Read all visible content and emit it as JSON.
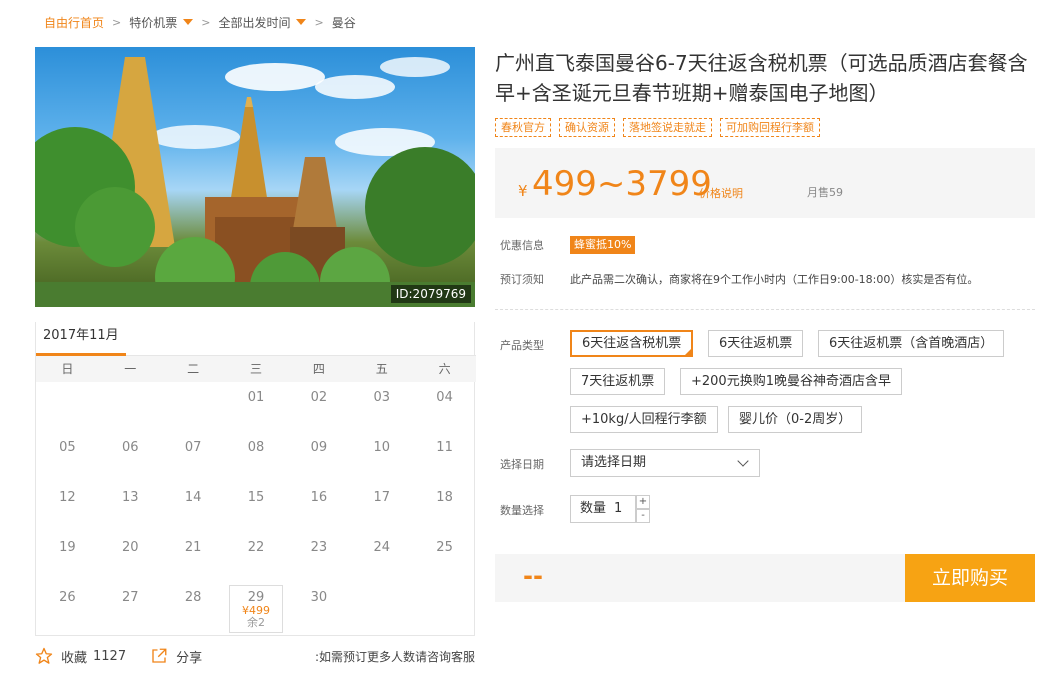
{
  "breadcrumb": {
    "home": "自由行首页",
    "items": [
      "特价机票",
      "全部出发时间",
      "曼谷"
    ]
  },
  "hero": {
    "image_id": "ID:2079769"
  },
  "calendar": {
    "month": "2017年11月",
    "weekdays": [
      "日",
      "一",
      "二",
      "三",
      "四",
      "五",
      "六"
    ],
    "days": [
      {
        "d": ""
      },
      {
        "d": ""
      },
      {
        "d": ""
      },
      {
        "d": "01"
      },
      {
        "d": "02"
      },
      {
        "d": "03"
      },
      {
        "d": "04"
      },
      {
        "d": "05"
      },
      {
        "d": "06"
      },
      {
        "d": "07"
      },
      {
        "d": "08"
      },
      {
        "d": "09"
      },
      {
        "d": "10"
      },
      {
        "d": "11"
      },
      {
        "d": "12"
      },
      {
        "d": "13"
      },
      {
        "d": "14"
      },
      {
        "d": "15"
      },
      {
        "d": "16"
      },
      {
        "d": "17"
      },
      {
        "d": "18"
      },
      {
        "d": "19"
      },
      {
        "d": "20"
      },
      {
        "d": "21"
      },
      {
        "d": "22"
      },
      {
        "d": "23"
      },
      {
        "d": "24"
      },
      {
        "d": "25"
      },
      {
        "d": "26"
      },
      {
        "d": "27"
      },
      {
        "d": "28"
      },
      {
        "d": "29",
        "price": "¥499",
        "stock": "余2"
      },
      {
        "d": "30"
      },
      {
        "d": ""
      },
      {
        "d": ""
      }
    ]
  },
  "actions": {
    "favorite_label": "收藏",
    "favorite_count": "1127",
    "share_label": "分享",
    "note": "如需预订更多人数请咨询客服"
  },
  "product": {
    "title": "广州直飞泰国曼谷6-7天往返含税机票（可选品质酒店套餐含早+含圣诞元旦春节班期+赠泰国电子地图）",
    "tags": [
      "春秋官方",
      "确认资源",
      "落地签说走就走",
      "可加购回程行李额"
    ],
    "price_symbol": "¥",
    "price_range": "499~3799",
    "price_note": "价格说明",
    "monthly_sales": "月售59",
    "promo_label": "优惠信息",
    "promo_badge": "蜂蜜抵10%",
    "booking_label": "预订须知",
    "booking_text": "此产品需二次确认，商家将在9个工作小时内（工作日9:00-18:00）核实是否有位。",
    "type_label": "产品类型",
    "options": [
      "6天往返含税机票",
      "6天往返机票",
      "6天往返机票（含首晚酒店）",
      "7天往返机票",
      "+200元换购1晚曼谷神奇酒店含早",
      "+10kg/人回程行李额",
      "婴儿价（0-2周岁）"
    ],
    "date_label": "选择日期",
    "date_placeholder": "请选择日期",
    "qty_label": "数量选择",
    "qty_prefix": "数量",
    "qty_value": "1",
    "qty_plus": "+",
    "qty_minus": "-",
    "total_placeholder": "--",
    "buy_label": "立即购买"
  },
  "colors": {
    "accent": "#f08519",
    "buy": "#f7a313"
  }
}
